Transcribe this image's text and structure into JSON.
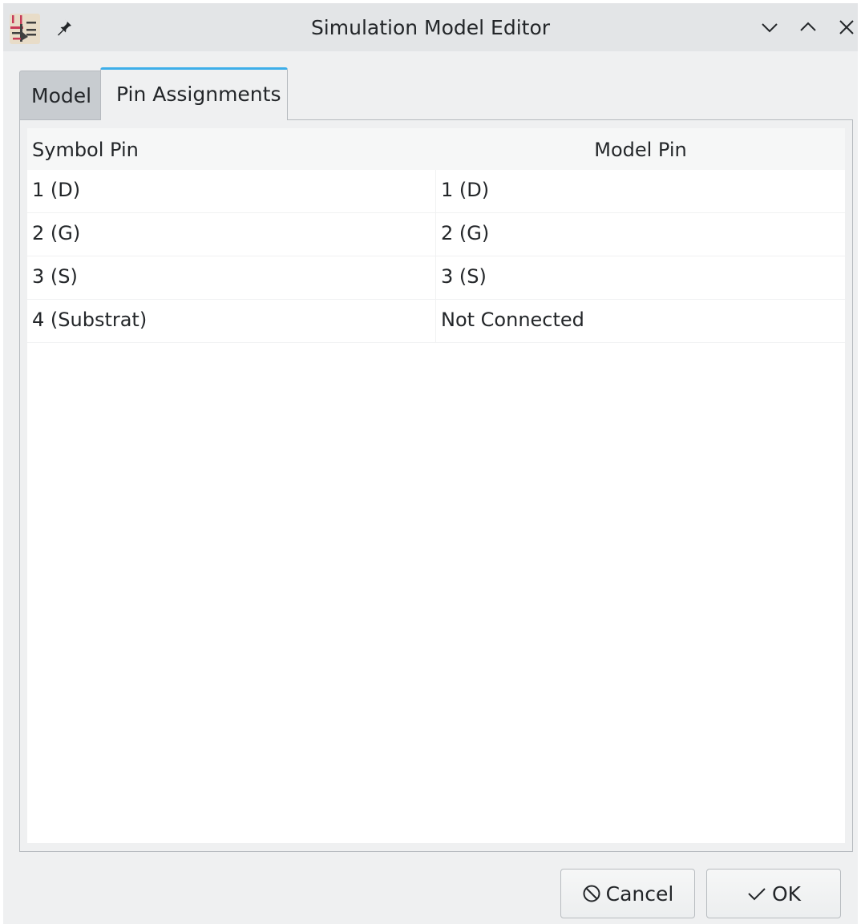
{
  "window": {
    "title": "Simulation Model Editor",
    "icons": {
      "app": "kicad-symbol-editor-icon",
      "pin": "pin-icon",
      "minimize": "chevron-down-icon",
      "maximize": "chevron-up-icon",
      "close": "close-icon"
    }
  },
  "tabs": [
    {
      "label": "Model",
      "selected": false
    },
    {
      "label": "Pin Assignments",
      "selected": true
    }
  ],
  "grid": {
    "columns": [
      "Symbol Pin",
      "Model Pin"
    ],
    "rows": [
      {
        "symbol_pin": "1 (D)",
        "model_pin": "1 (D)"
      },
      {
        "symbol_pin": "2 (G)",
        "model_pin": "2 (G)"
      },
      {
        "symbol_pin": "3 (S)",
        "model_pin": "3 (S)"
      },
      {
        "symbol_pin": "4 (Substrat)",
        "model_pin": "Not Connected"
      }
    ]
  },
  "buttons": {
    "cancel_label": "Cancel",
    "ok_label": "OK",
    "cancel_icon": "cancel-icon",
    "ok_icon": "checkmark-icon"
  },
  "colors": {
    "accent": "#3daee9",
    "window_bg": "#eff0f1",
    "titlebar_bg": "#e3e5e7",
    "inactive_tab_bg": "#c8ccd0"
  }
}
